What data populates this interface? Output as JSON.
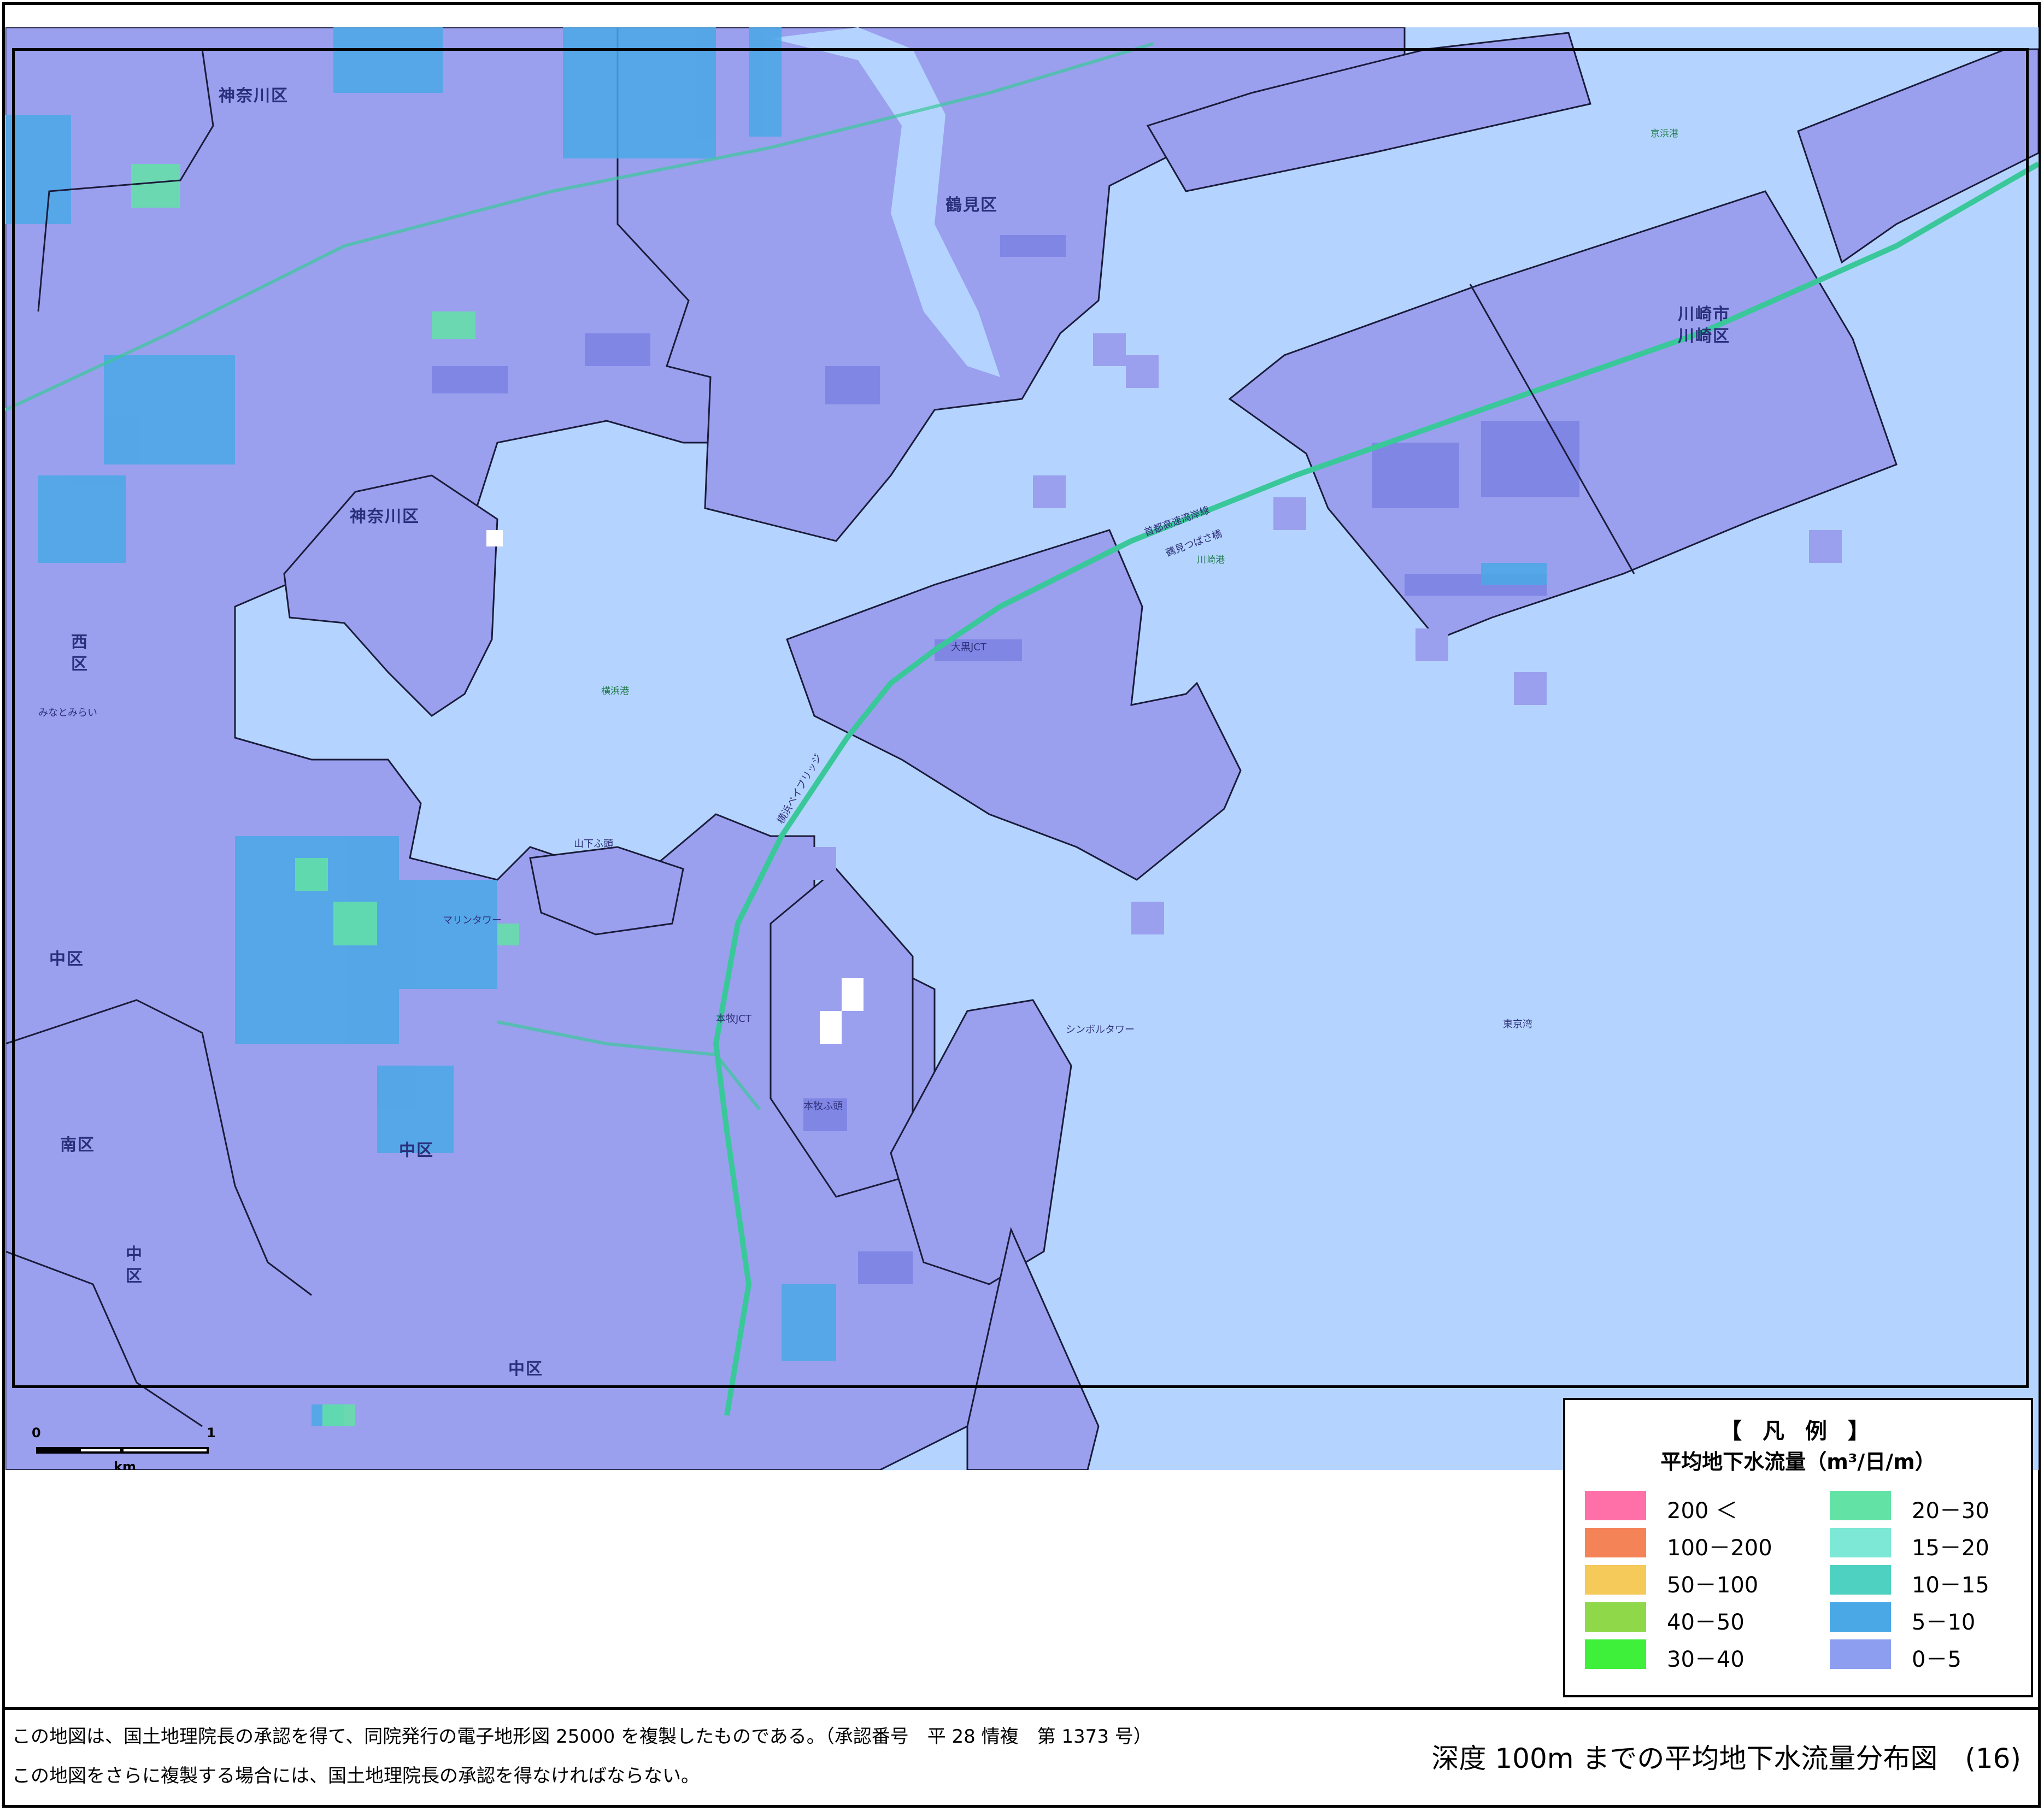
{
  "map": {
    "colors": {
      "sea": "#b4d4ff",
      "land": "#9aa0ee",
      "land_dark": "#7f86e4",
      "cell_low": "#8d9ef0",
      "cell_5_10": "#4aa8e6",
      "cell_10_15": "#4fd1c2",
      "cell_green": "#63e2a6",
      "outline": "#1b1b3b"
    },
    "labels": {
      "kanagawa_top": "神奈川区",
      "kanagawa_mid": "神奈川区",
      "tsurumi": "鶴見区",
      "kawasaki_city": "川崎市",
      "kawasaki_ward": "川崎区",
      "nishi_1": "西",
      "nishi_2": "区",
      "naka_west": "中区",
      "naka_center": "中区",
      "minami": "南区",
      "naka_left_1": "中",
      "naka_left_2": "区",
      "naka_bottom": "中区"
    },
    "small_labels": {
      "yokohama_port": "横浜港",
      "kawasaki_port": "川崎港",
      "keihin_port": "京浜港",
      "tokyo_bay": "東京湾",
      "yamashita_pier": "山下ふ頭",
      "daikoku_jct": "大黒JCT",
      "honmoku_jct": "本牧JCT",
      "symbol_tower": "シンボルタワー",
      "wangan_line": "首都高速湾岸線",
      "tsubasa_bridge": "鶴見つばさ橋",
      "bay_bridge": "横浜ベイブリッジ",
      "marine_tower": "マリンタワー",
      "minatomirai": "みなとみらい",
      "honmoku_pier": "本牧ふ頭"
    }
  },
  "scale": {
    "zero": "0",
    "one": "1",
    "unit": "km"
  },
  "legend": {
    "title": "【 凡 例 】",
    "subtitle": "平均地下水流量（m³/日/m）",
    "items": [
      {
        "label": "200 ＜",
        "color": "#ff6fa8"
      },
      {
        "label": "100－200",
        "color": "#f48458"
      },
      {
        "label": "50－100",
        "color": "#f5c95a"
      },
      {
        "label": "40－50",
        "color": "#8ed84a"
      },
      {
        "label": "30－40",
        "color": "#3ff03a"
      },
      {
        "label": "20－30",
        "color": "#63e2a6"
      },
      {
        "label": "15－20",
        "color": "#7de8d6"
      },
      {
        "label": "10－15",
        "color": "#4fd1c2"
      },
      {
        "label": "5－10",
        "color": "#4aa8e6"
      },
      {
        "label": "0－5",
        "color": "#8d9ef0"
      }
    ]
  },
  "footer": {
    "line1": "この地図は、国土地理院長の承認を得て、同院発行の電子地形図 25000 を複製したものである。（承認番号　平 28 情複　第 1373 号）",
    "line2": "この地図をさらに複製する場合には、国土地理院長の承認を得なければならない。",
    "title": "深度 100m までの平均地下水流量分布図　(16)"
  }
}
